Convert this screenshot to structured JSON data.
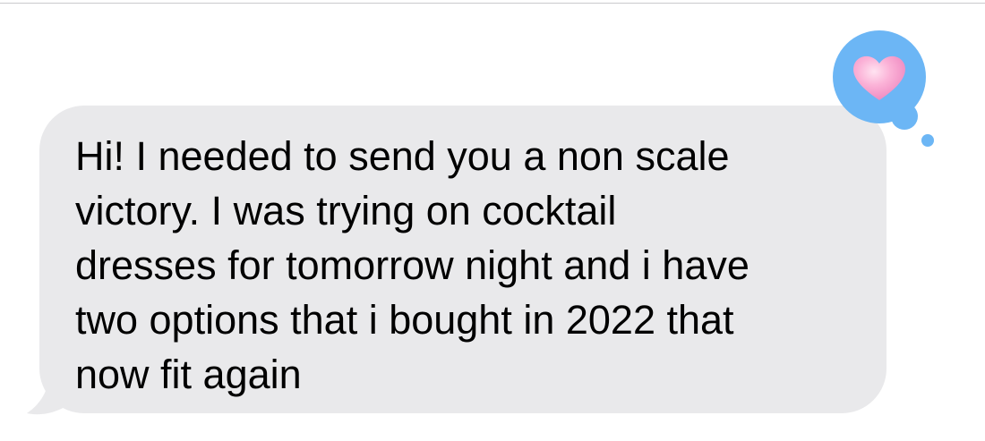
{
  "conversation": {
    "incoming_message": {
      "text": "Hi! I needed to send you a non scale\nvictory. I was trying on cocktail\ndresses for tomorrow night and i have\ntwo options that i bought in 2022 that\nnow fit again"
    },
    "tapback": {
      "icon": "heart-icon",
      "reaction": "heart",
      "bubble_color": "#6cb6f5",
      "heart_color": "#f7a8cf"
    },
    "bubble_color": "#e9e9eb"
  }
}
